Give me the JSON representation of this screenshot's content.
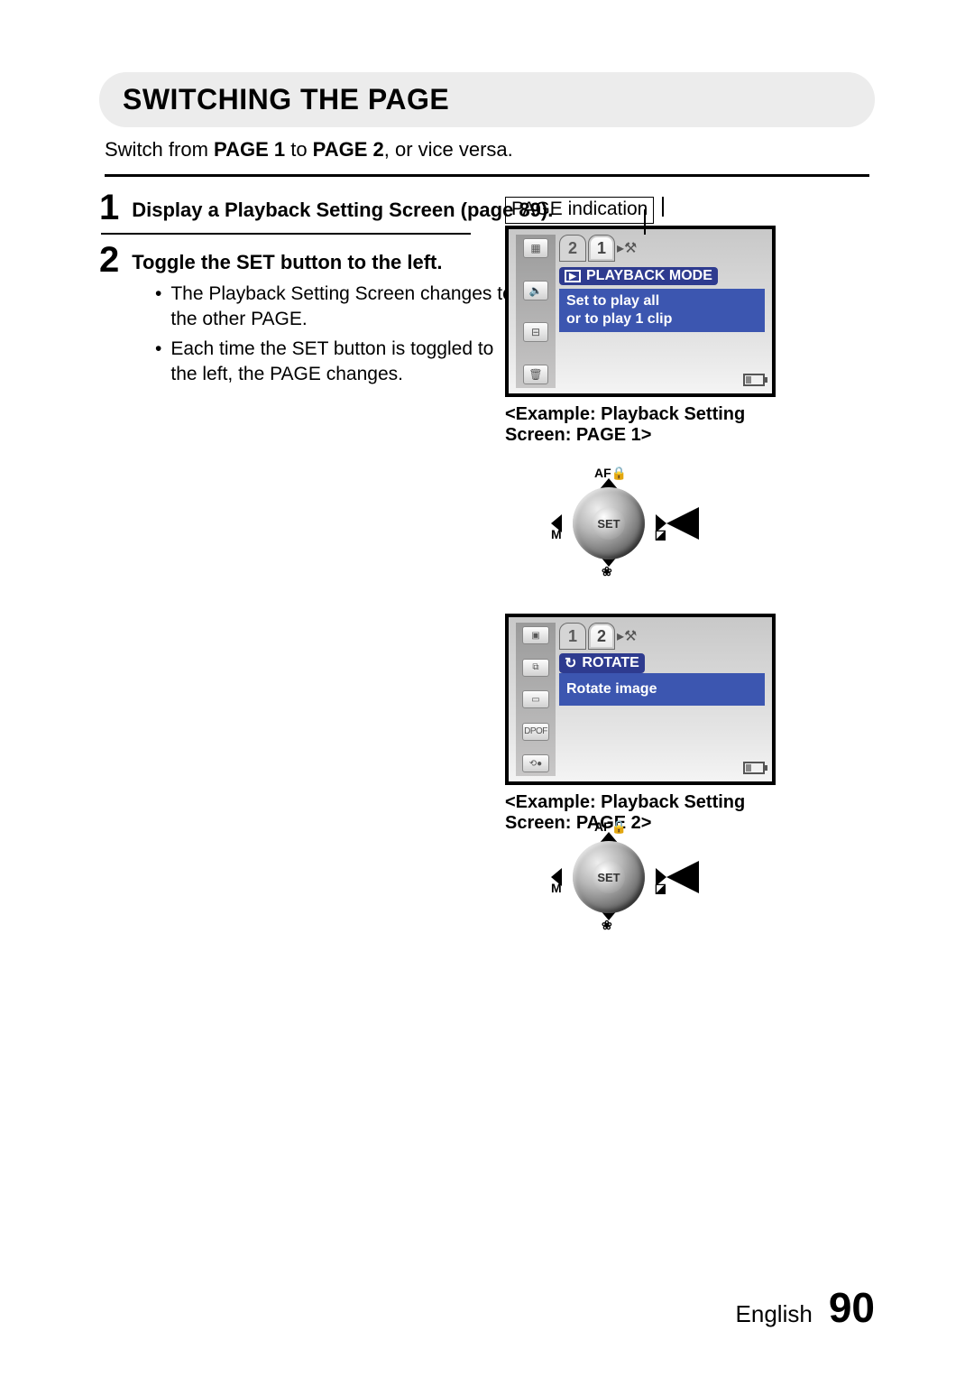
{
  "title": "SWITCHING THE PAGE",
  "intro_pre": "Switch from ",
  "intro_b1": "PAGE 1",
  "intro_mid": " to ",
  "intro_b2": "PAGE 2",
  "intro_post": ", or vice versa.",
  "steps": {
    "s1_num": "1",
    "s1_title": "Display a Playback Setting Screen (page 89).",
    "s2_num": "2",
    "s2_title": "Toggle the SET button to the left.",
    "s2_b1": "The Playback Setting Screen changes to the other PAGE.",
    "s2_b2": "Each time the SET button is toggled to the left, the PAGE changes."
  },
  "figure": {
    "page_indication_label": "PAGE indication",
    "screen1": {
      "tabs": {
        "left": "2",
        "active": "1",
        "icon": "▸⚒"
      },
      "mode_label": "PLAYBACK MODE",
      "desc_line1": "Set to play all",
      "desc_line2": "or to play 1 clip",
      "strip_icons": [
        "▦",
        "🔈",
        "⊟",
        "🗑"
      ]
    },
    "caption1": "<Example: Playback Setting Screen: PAGE 1>",
    "joystick": {
      "top": "AF🔒",
      "left": "M",
      "right": "◪",
      "bottom": "❀",
      "center": "SET"
    },
    "screen2": {
      "tabs": {
        "left": "1",
        "active": "2",
        "icon": "▸⚒"
      },
      "mode_label": "ROTATE",
      "mode_icon": "↻",
      "desc": "Rotate image",
      "strip_icons": [
        "▣",
        "⧉",
        "▭",
        "DPOF",
        "⟲●"
      ]
    },
    "caption2": "<Example: Playback Setting Screen: PAGE 2>"
  },
  "footer": {
    "language": "English",
    "page_number": "90"
  }
}
